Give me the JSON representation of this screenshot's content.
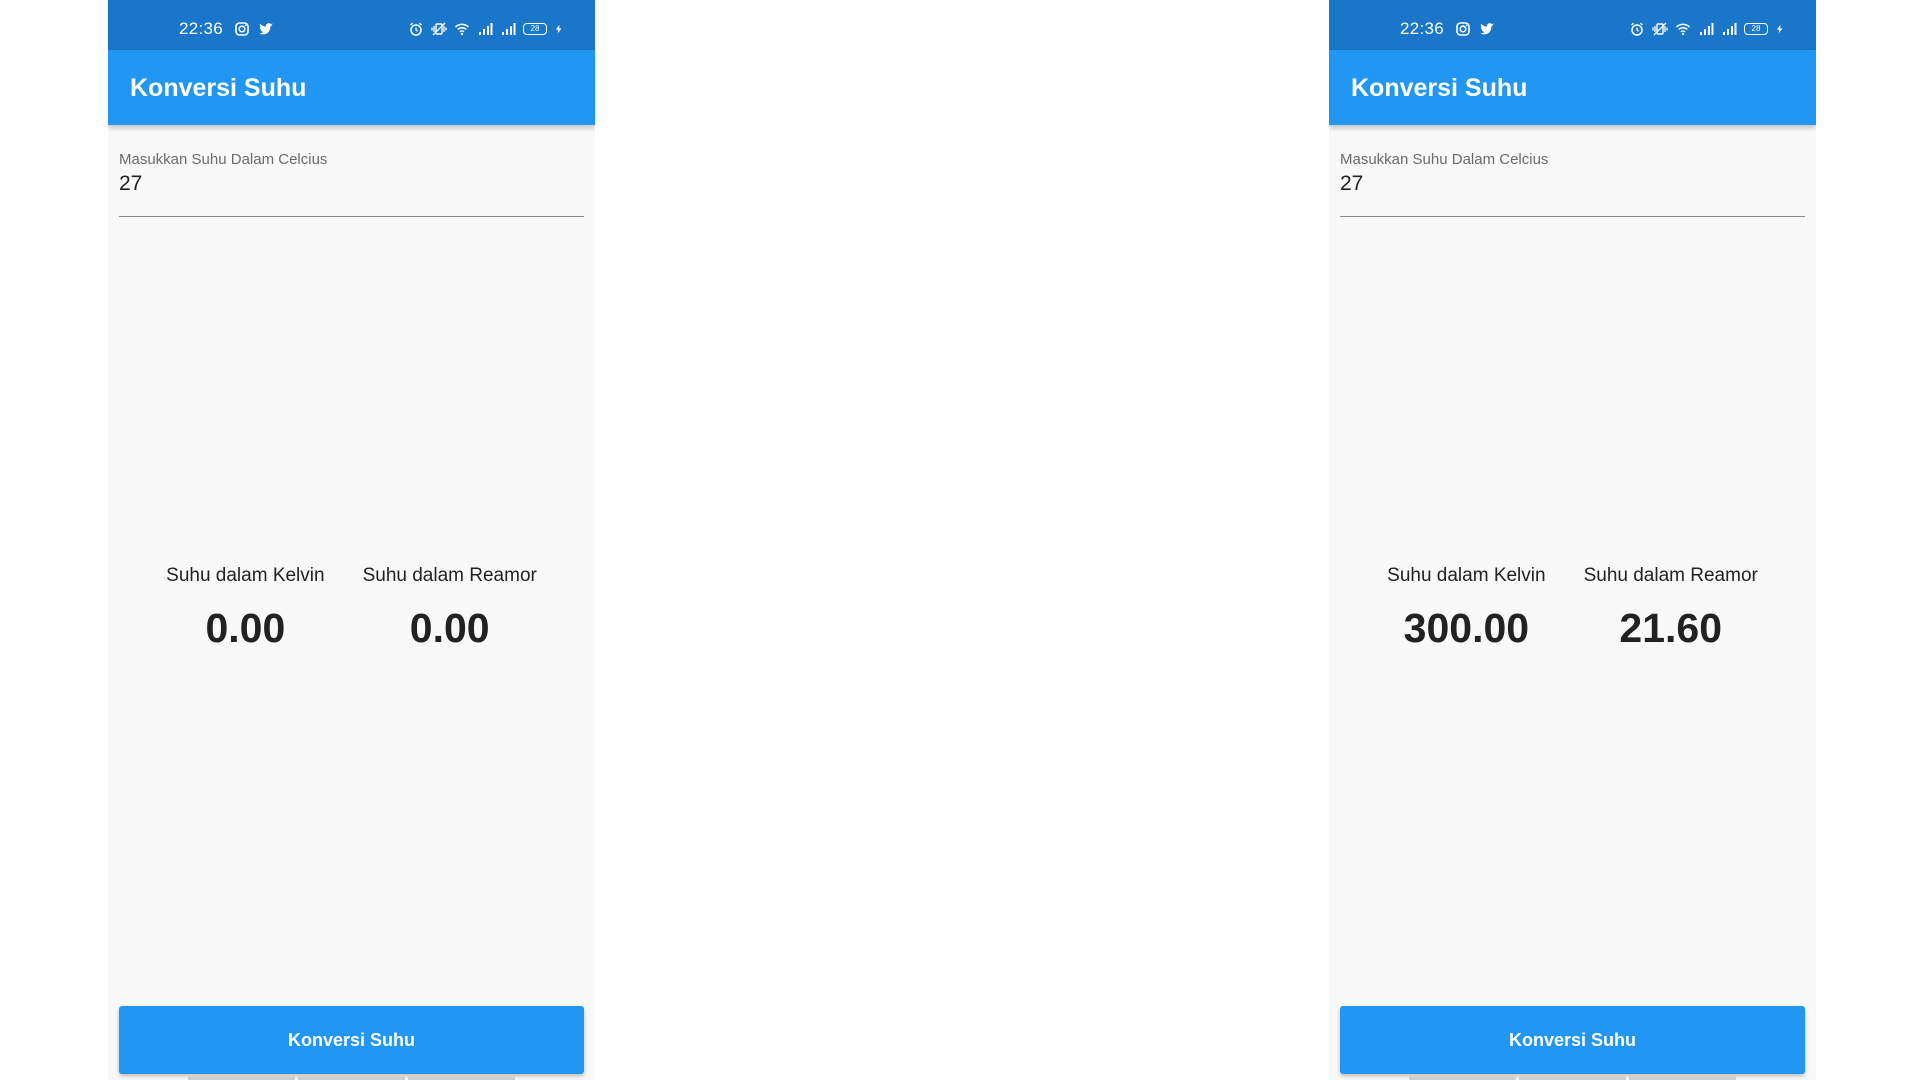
{
  "colors": {
    "status_bar": "#1976c8",
    "app_bar": "#2196f3",
    "background": "#f9f9f9",
    "button": "#2196f3"
  },
  "screens": [
    {
      "status_bar": {
        "time": "22:36",
        "left_icons": [
          "instagram-icon",
          "twitter-icon"
        ],
        "right_icons": [
          "alarm-icon",
          "vibrate-icon",
          "wifi-icon",
          "signal-icon",
          "signal-icon",
          "battery-icon",
          "charging-icon"
        ],
        "battery_level": "28"
      },
      "app_bar": {
        "title": "Konversi Suhu"
      },
      "input": {
        "label": "Masukkan Suhu Dalam Celcius",
        "value": "27"
      },
      "results": [
        {
          "label": "Suhu dalam Kelvin",
          "value": "0.00"
        },
        {
          "label": "Suhu dalam Reamor",
          "value": "0.00"
        }
      ],
      "button_label": "Konversi Suhu"
    },
    {
      "status_bar": {
        "time": "22:36",
        "left_icons": [
          "instagram-icon",
          "twitter-icon"
        ],
        "right_icons": [
          "alarm-icon",
          "vibrate-icon",
          "wifi-icon",
          "signal-icon",
          "signal-icon",
          "battery-icon",
          "charging-icon"
        ],
        "battery_level": "28"
      },
      "app_bar": {
        "title": "Konversi Suhu"
      },
      "input": {
        "label": "Masukkan Suhu Dalam Celcius",
        "value": "27"
      },
      "results": [
        {
          "label": "Suhu dalam Kelvin",
          "value": "300.00"
        },
        {
          "label": "Suhu dalam Reamor",
          "value": "21.60"
        }
      ],
      "button_label": "Konversi Suhu"
    }
  ]
}
